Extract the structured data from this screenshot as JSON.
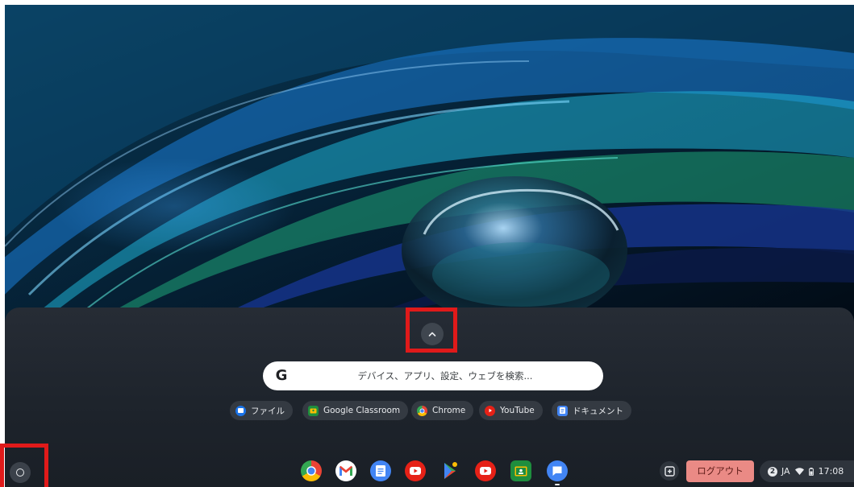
{
  "launcher": {
    "search_placeholder": "デバイス、アプリ、設定、ウェブを検索...",
    "search_logo": "G",
    "chips": [
      {
        "label": "ファイル",
        "icon": "files-icon",
        "color": "#1a73e8"
      },
      {
        "label": "Google Classroom",
        "icon": "classroom-icon",
        "color": "#1e8e3e"
      },
      {
        "label": "Chrome",
        "icon": "chrome-icon",
        "color": "#fbbc04"
      },
      {
        "label": "YouTube",
        "icon": "youtube-icon",
        "color": "#e62117"
      },
      {
        "label": "ドキュメント",
        "icon": "docs-icon",
        "color": "#4285f4"
      }
    ]
  },
  "shelf": {
    "apps": [
      {
        "name": "chrome",
        "icon": "chrome-icon"
      },
      {
        "name": "gmail",
        "icon": "gmail-icon"
      },
      {
        "name": "docs",
        "icon": "docs-icon"
      },
      {
        "name": "youtube",
        "icon": "youtube-icon"
      },
      {
        "name": "play-store",
        "icon": "play-store-icon"
      },
      {
        "name": "youtube-music",
        "icon": "youtube-icon"
      },
      {
        "name": "classroom",
        "icon": "classroom-icon"
      },
      {
        "name": "chat",
        "icon": "chat-icon"
      }
    ],
    "logout_label": "ログアウト",
    "status": {
      "notification_count": "2",
      "ime": "JA",
      "time": "17:08"
    }
  },
  "colors": {
    "highlight": "#e01a1a",
    "logout_bg": "#ea8a85",
    "shelf_bg": "#1a1f26"
  }
}
